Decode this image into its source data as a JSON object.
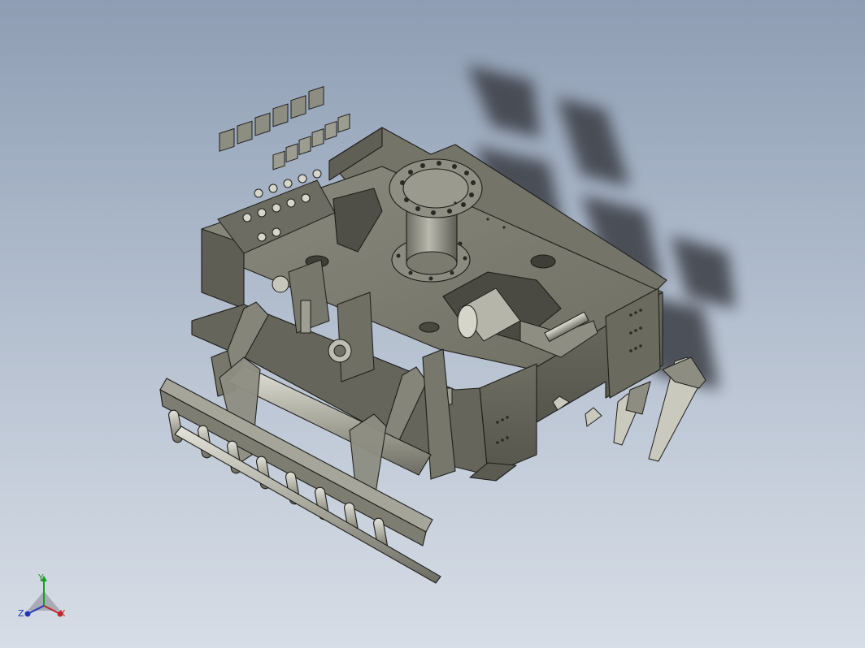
{
  "viewport": {
    "background_top": "#8e9db3",
    "background_bottom": "#d7dde6"
  },
  "model": {
    "body_color": "#7b7b70",
    "edge_color": "#1e1e1a",
    "metal_color": "#cfcfc4"
  },
  "triad": {
    "x_label": "X",
    "y_label": "Y",
    "z_label": "Z",
    "x_color": "#c0262a",
    "y_color": "#1f9a2a",
    "z_color": "#2037b0"
  }
}
